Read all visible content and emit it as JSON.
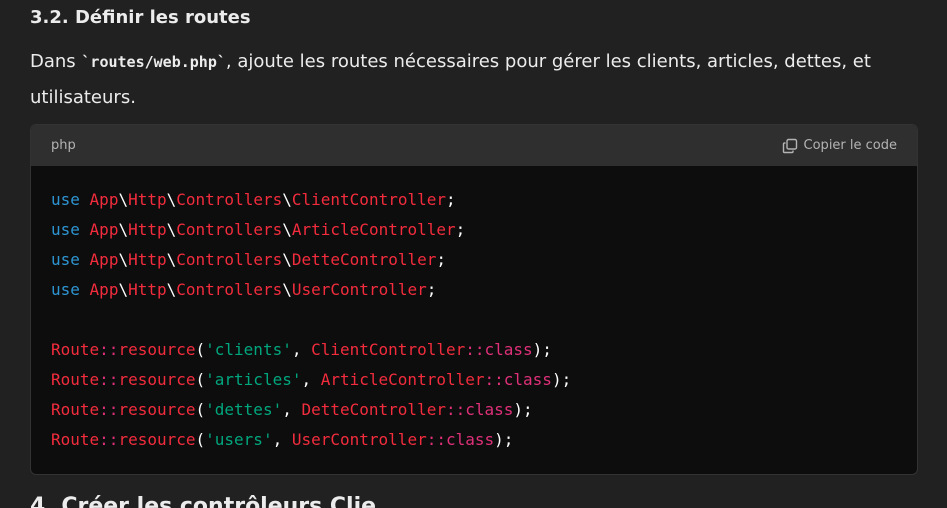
{
  "section": {
    "title": "3.2. Définir les routes"
  },
  "paragraph": {
    "before": "Dans ",
    "code": "`routes/web.php`",
    "after": ", ajoute les routes nécessaires pour gérer les clients, articles, dettes, et utilisateurs."
  },
  "code_block": {
    "language": "php",
    "copy_label": "Copier le code",
    "copy_icon": "copy-icon",
    "lines": [
      [
        [
          "k",
          "use"
        ],
        [
          "w",
          " "
        ],
        [
          "r",
          "App"
        ],
        [
          "w",
          "\\"
        ],
        [
          "r",
          "Http"
        ],
        [
          "w",
          "\\"
        ],
        [
          "r",
          "Controllers"
        ],
        [
          "w",
          "\\"
        ],
        [
          "r",
          "ClientController"
        ],
        [
          "w",
          ";"
        ]
      ],
      [
        [
          "k",
          "use"
        ],
        [
          "w",
          " "
        ],
        [
          "r",
          "App"
        ],
        [
          "w",
          "\\"
        ],
        [
          "r",
          "Http"
        ],
        [
          "w",
          "\\"
        ],
        [
          "r",
          "Controllers"
        ],
        [
          "w",
          "\\"
        ],
        [
          "r",
          "ArticleController"
        ],
        [
          "w",
          ";"
        ]
      ],
      [
        [
          "k",
          "use"
        ],
        [
          "w",
          " "
        ],
        [
          "r",
          "App"
        ],
        [
          "w",
          "\\"
        ],
        [
          "r",
          "Http"
        ],
        [
          "w",
          "\\"
        ],
        [
          "r",
          "Controllers"
        ],
        [
          "w",
          "\\"
        ],
        [
          "r",
          "DetteController"
        ],
        [
          "w",
          ";"
        ]
      ],
      [
        [
          "k",
          "use"
        ],
        [
          "w",
          " "
        ],
        [
          "r",
          "App"
        ],
        [
          "w",
          "\\"
        ],
        [
          "r",
          "Http"
        ],
        [
          "w",
          "\\"
        ],
        [
          "r",
          "Controllers"
        ],
        [
          "w",
          "\\"
        ],
        [
          "r",
          "UserController"
        ],
        [
          "w",
          ";"
        ]
      ],
      [],
      [
        [
          "r",
          "Route"
        ],
        [
          "m",
          "::"
        ],
        [
          "r",
          "resource"
        ],
        [
          "w",
          "("
        ],
        [
          "s",
          "'clients'"
        ],
        [
          "w",
          ", "
        ],
        [
          "r",
          "ClientController"
        ],
        [
          "m",
          "::"
        ],
        [
          "m",
          "class"
        ],
        [
          "w",
          ");"
        ]
      ],
      [
        [
          "r",
          "Route"
        ],
        [
          "m",
          "::"
        ],
        [
          "r",
          "resource"
        ],
        [
          "w",
          "("
        ],
        [
          "s",
          "'articles'"
        ],
        [
          "w",
          ", "
        ],
        [
          "r",
          "ArticleController"
        ],
        [
          "m",
          "::"
        ],
        [
          "m",
          "class"
        ],
        [
          "w",
          ");"
        ]
      ],
      [
        [
          "r",
          "Route"
        ],
        [
          "m",
          "::"
        ],
        [
          "r",
          "resource"
        ],
        [
          "w",
          "("
        ],
        [
          "s",
          "'dettes'"
        ],
        [
          "w",
          ", "
        ],
        [
          "r",
          "DetteController"
        ],
        [
          "m",
          "::"
        ],
        [
          "m",
          "class"
        ],
        [
          "w",
          ");"
        ]
      ],
      [
        [
          "r",
          "Route"
        ],
        [
          "m",
          "::"
        ],
        [
          "r",
          "resource"
        ],
        [
          "w",
          "("
        ],
        [
          "s",
          "'users'"
        ],
        [
          "w",
          ", "
        ],
        [
          "r",
          "UserController"
        ],
        [
          "m",
          "::"
        ],
        [
          "m",
          "class"
        ],
        [
          "w",
          ");"
        ]
      ]
    ]
  },
  "next_heading": {
    "text": "4. Créer les contrôleurs Clie"
  },
  "colors": {
    "background": "#212121",
    "code_background": "#0d0d0d",
    "header_background": "#2f2f2f",
    "keyword": "#2e95d3",
    "identifier": "#f22c3d",
    "string": "#00a67d",
    "operator": "#df3079"
  }
}
